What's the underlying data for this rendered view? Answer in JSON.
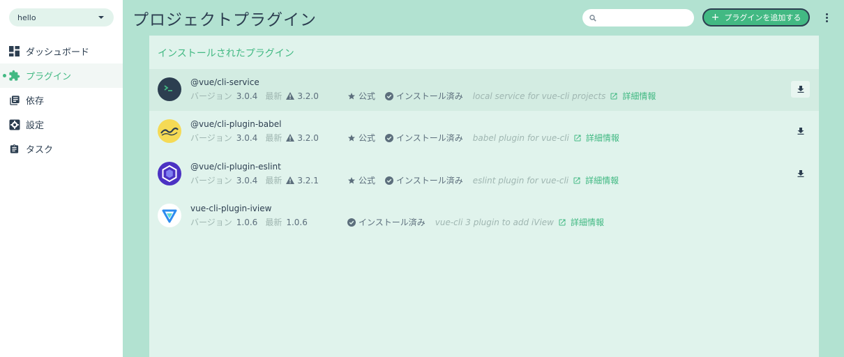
{
  "sidebar": {
    "project": "hello",
    "items": [
      {
        "label": "ダッシュボード",
        "icon": "dashboard-icon"
      },
      {
        "label": "プラグイン",
        "icon": "puzzle-icon",
        "active": true
      },
      {
        "label": "依存",
        "icon": "library-books-icon"
      },
      {
        "label": "設定",
        "icon": "settings-icon"
      },
      {
        "label": "タスク",
        "icon": "clipboard-icon"
      }
    ]
  },
  "header": {
    "title": "プロジェクトプラグイン",
    "search_placeholder": "",
    "add_button": "プラグインを追加する"
  },
  "panel": {
    "title": "インストールされたプラグイン",
    "version_label": "バージョン",
    "latest_label": "最新",
    "official_label": "公式",
    "installed_label": "インストール済み",
    "more_info_label": "詳細情報",
    "plugins": [
      {
        "name": "@vue/cli-service",
        "version": "3.0.4",
        "latest": "3.2.0",
        "official": true,
        "description": "local service for vue-cli projects"
      },
      {
        "name": "@vue/cli-plugin-babel",
        "version": "3.0.4",
        "latest": "3.2.0",
        "official": true,
        "description": "babel plugin for vue-cli"
      },
      {
        "name": "@vue/cli-plugin-eslint",
        "version": "3.0.4",
        "latest": "3.2.1",
        "official": true,
        "description": "eslint plugin for vue-cli"
      },
      {
        "name": "vue-cli-plugin-iview",
        "version": "1.0.6",
        "latest": "1.0.6",
        "official": false,
        "description": "vue-cli 3 plugin to add iView"
      }
    ]
  },
  "colors": {
    "accent": "#42b983",
    "text": "#2c3e50",
    "background": "#b2e2d1"
  }
}
